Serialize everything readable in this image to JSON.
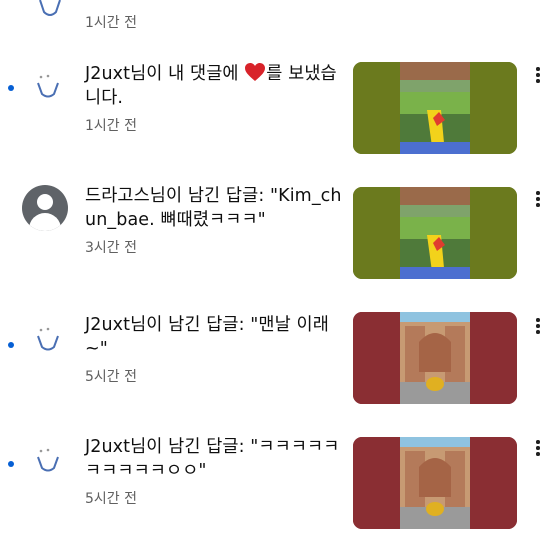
{
  "notifications": [
    {
      "message": "",
      "time": "1시간 전",
      "avatar": "logo",
      "unread": true,
      "thumb": "none"
    },
    {
      "message_before": "J2uxt님이 내 댓글에 ",
      "message_after": "를 보냈습니다.",
      "emoji": "heart-icon",
      "time": "1시간 전",
      "avatar": "logo",
      "unread": true,
      "thumb": "green"
    },
    {
      "message": "드라고스님이 남긴 답글: \"Kim_chun_bae. 뼈때렸ㅋㅋㅋ\"",
      "time": "3시간 전",
      "avatar": "person",
      "unread": false,
      "thumb": "green"
    },
    {
      "message": "J2uxt님이 남긴 답글: \"맨날 이래~\"",
      "time": "5시간 전",
      "avatar": "logo",
      "unread": true,
      "thumb": "red"
    },
    {
      "message": "J2uxt님이 남긴 답글: \"ㅋㅋㅋㅋㅋㅋㅋㅋㅋㅋㅇㅇ\"",
      "time": "5시간 전",
      "avatar": "logo",
      "unread": true,
      "thumb": "red"
    }
  ],
  "colors": {
    "unread_dot": "#065fd4",
    "thumb_green": "#6b7a1e",
    "thumb_red": "#8a2e33",
    "heart": "#d8232a"
  }
}
